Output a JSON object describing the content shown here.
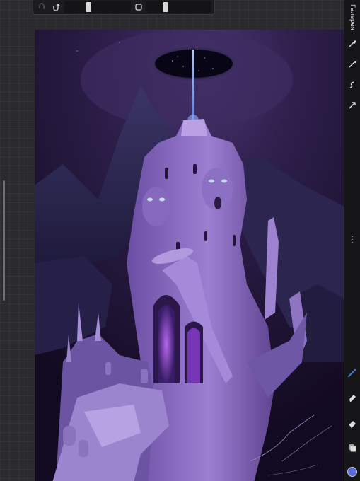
{
  "app": {
    "gallery_label": "Галерея"
  },
  "topbar": {
    "undo_icon": "undo-icon",
    "redo_icon": "redo-icon",
    "brush_size_value": 0.5,
    "opacity_value": 0.5,
    "modify_icon": "square-icon"
  },
  "sidebar": {
    "tools": [
      {
        "name": "actions-icon"
      },
      {
        "name": "adjustments-icon"
      },
      {
        "name": "selection-icon"
      },
      {
        "name": "transform-icon"
      }
    ],
    "more_icon": "more-icon",
    "bottom_tools": [
      {
        "name": "brush-icon"
      },
      {
        "name": "smudge-icon"
      },
      {
        "name": "eraser-icon"
      },
      {
        "name": "layers-icon"
      }
    ],
    "current_color": "#5b6bd8"
  },
  "colors": {
    "accent_brush": "#3d7bd9",
    "sky_dark": "#140a22",
    "castle_purple": "#8d6cc6",
    "beam": "#8fb4ff"
  }
}
